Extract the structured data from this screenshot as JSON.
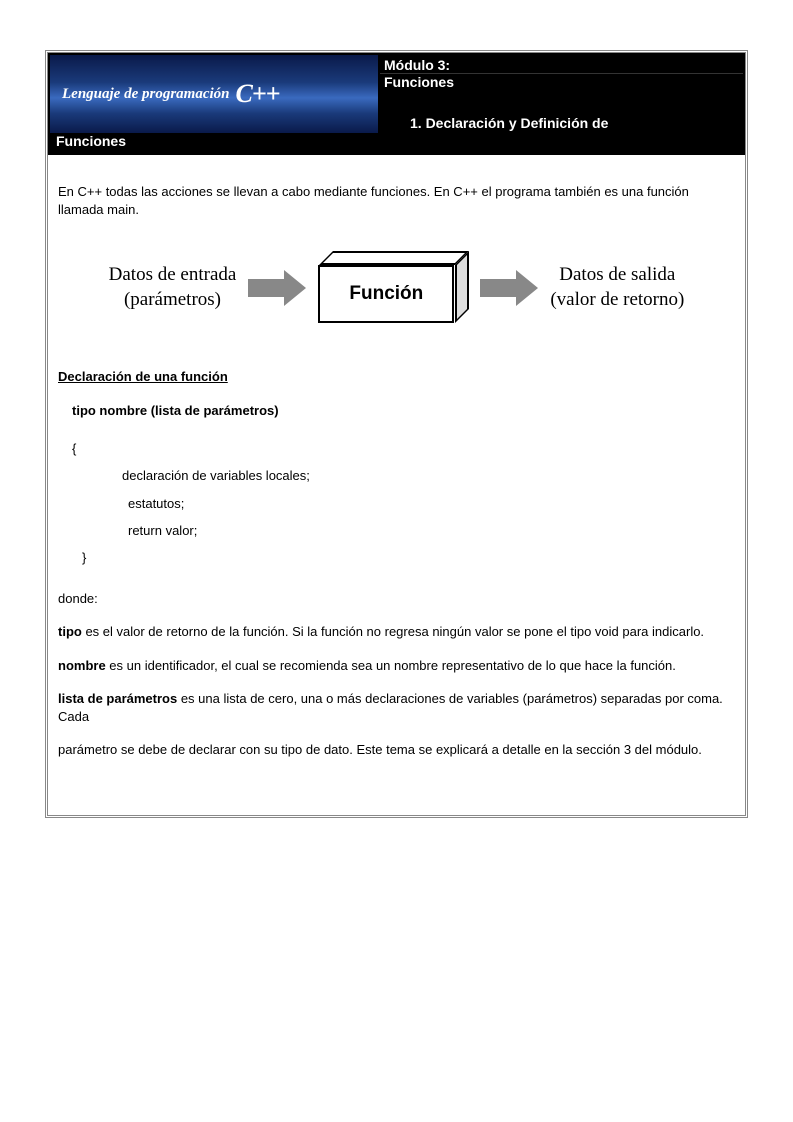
{
  "header": {
    "banner_text": "Lenguaje de programación",
    "banner_cpp": "C++",
    "module_label": "Módulo 3:",
    "module_title": "Funciones",
    "section_number": "1. Declaración y Definición de",
    "section_word": "Funciones"
  },
  "content": {
    "intro": "En C++ todas las acciones se llevan a cabo mediante funciones. En C++ el programa también es una función llamada main.",
    "diagram": {
      "left_line1": "Datos de entrada",
      "left_line2": "(parámetros)",
      "box_label": "Función",
      "right_line1": "Datos de salida",
      "right_line2": "(valor de retorno)"
    },
    "section_heading": "Declaración de una función",
    "syntax_signature": "tipo nombre (lista de parámetros)",
    "code": {
      "open_brace": "{",
      "line1": "declaración de variables locales;",
      "line2": "estatutos;",
      "line3": "return valor;",
      "close_brace": "}"
    },
    "where_label": "donde:",
    "defs": {
      "tipo_bold": "tipo",
      "tipo_text": " es el valor de retorno de la función. Si la función no regresa ningún valor se pone el tipo void para indicarlo.",
      "nombre_bold": "nombre",
      "nombre_text": " es un identificador, el cual se recomienda sea un nombre representativo de lo que hace la función.",
      "lista_bold": "lista de parámetros",
      "lista_text": " es una lista de cero, una o más declaraciones de variables (parámetros) separadas por coma. Cada",
      "lista_cont": "parámetro se debe de declarar con su tipo de dato. Este tema se explicará a detalle en la sección 3 del módulo."
    }
  }
}
